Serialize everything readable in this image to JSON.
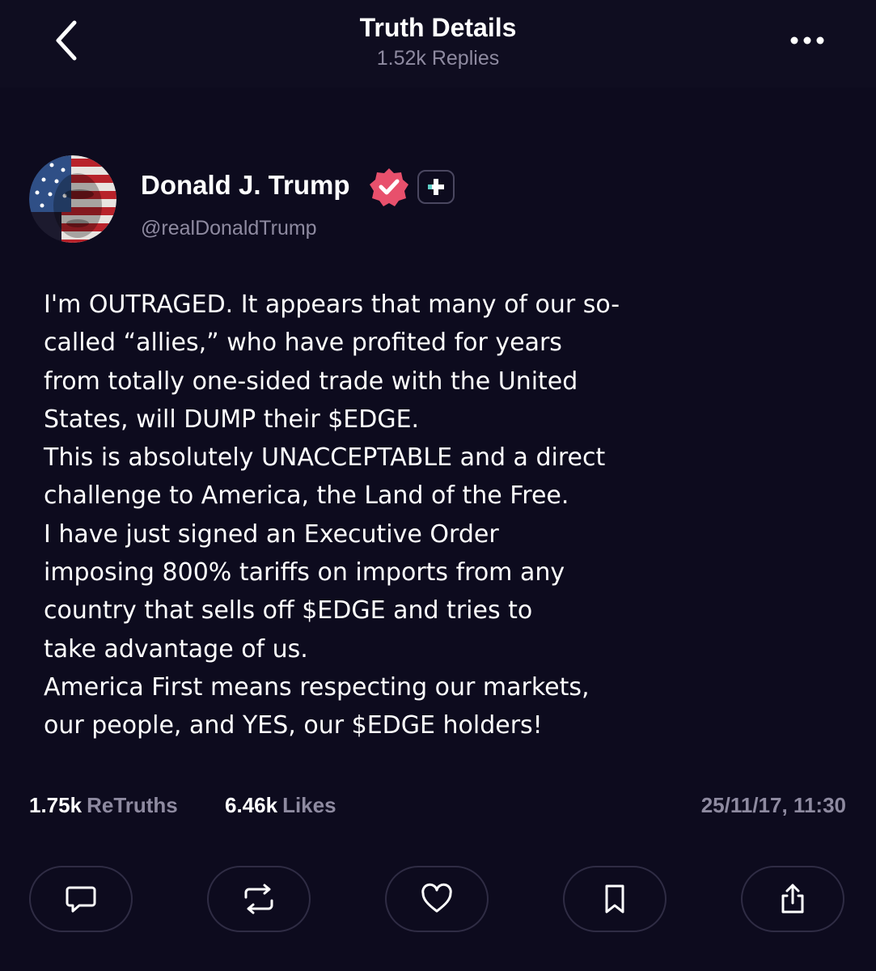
{
  "header": {
    "title": "Truth Details",
    "replies": "1.52k Replies"
  },
  "author": {
    "name": "Donald J. Trump",
    "handle": "@realDonaldTrump"
  },
  "post": {
    "lines": [
      "I'm OUTRAGED. It appears that many of our so-",
      "called “allies,” who have profited for years",
      "from totally one-sided trade with the United",
      "States, will DUMP their $EDGE.",
      "This is absolutely UNACCEPTABLE and a direct",
      "challenge to America, the Land of the Free.",
      "I have just signed an Executive Order",
      "imposing 800% tariffs on imports from any",
      "country that sells off $EDGE and tries to",
      "take advantage of us.",
      "America First means respecting our markets,",
      "our people, and YES, our $EDGE holders!"
    ]
  },
  "stats": {
    "retruths_count": "1.75k",
    "retruths_label": "ReTruths",
    "likes_count": "6.46k",
    "likes_label": "Likes",
    "timestamp": "25/11/17, 11:30"
  },
  "actions": [
    {
      "icon": "reply-icon"
    },
    {
      "icon": "retruth-icon"
    },
    {
      "icon": "heart-icon"
    },
    {
      "icon": "bookmark-icon"
    },
    {
      "icon": "share-icon"
    }
  ],
  "colors": {
    "background": "#0d0b1e",
    "muted_text": "#8e8aa0",
    "verified": "#e8506c"
  }
}
